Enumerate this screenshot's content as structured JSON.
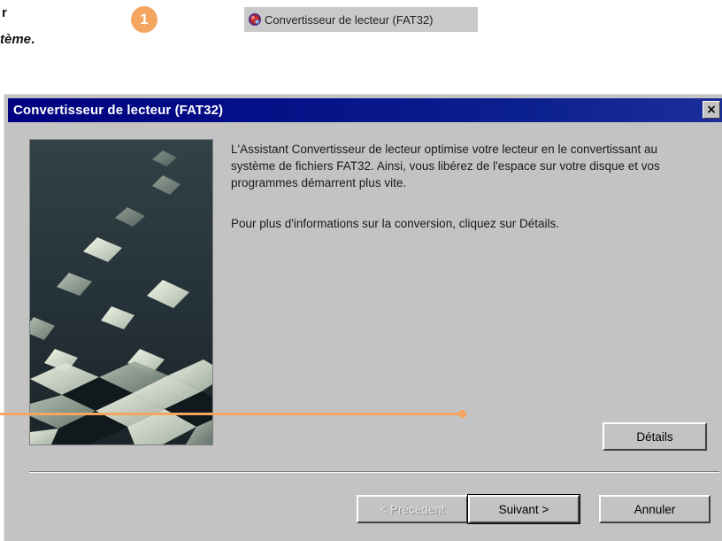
{
  "doc": {
    "line1": "r",
    "line2_prefix": "",
    "line2_italic": "tème",
    "line2_suffix": "."
  },
  "step": {
    "number": "1"
  },
  "menu_item": {
    "label": "Convertisseur de lecteur (FAT32)",
    "icon": "drive-converter-icon"
  },
  "dialog": {
    "title": "Convertisseur de lecteur (FAT32)",
    "close_label": "×",
    "paragraph1": "L'Assistant Convertisseur de lecteur optimise votre lecteur en le convertissant au système de fichiers FAT32. Ainsi, vous libérez de l'espace sur votre disque et vos programmes démarrent plus vite.",
    "paragraph2": "Pour plus d'informations sur la conversion, cliquez sur Détails.",
    "details_button": "Détails",
    "back_button": "< Précédent",
    "next_button": "Suivant >",
    "cancel_button": "Annuler"
  },
  "colors": {
    "accent_orange": "#f4a560",
    "titlebar_blue": "#000080",
    "dialog_gray": "#c3c3c3"
  }
}
